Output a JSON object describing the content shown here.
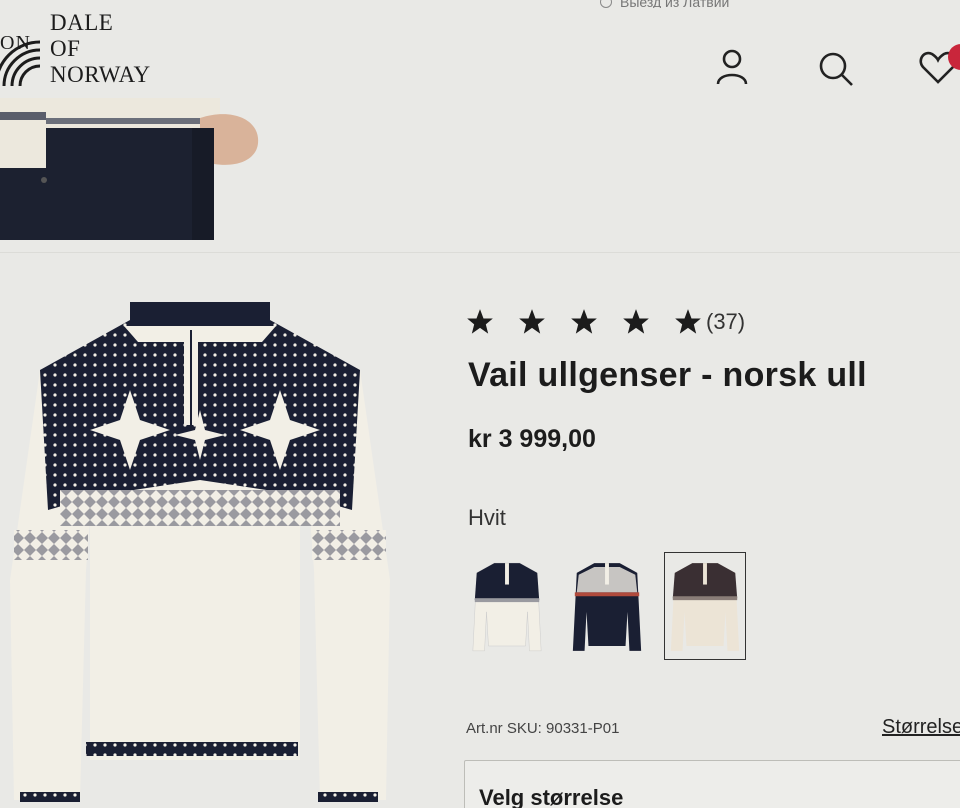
{
  "topbar": {
    "text": "Выезд из Латвии"
  },
  "header": {
    "logo": {
      "line1": "DALE",
      "line2": "OF",
      "line3": "NORWAY",
      "fragment": "ON"
    },
    "icons": [
      "account-icon",
      "search-icon",
      "wishlist-icon"
    ]
  },
  "product": {
    "rating": {
      "stars": 5,
      "max": 5,
      "count": "(37)"
    },
    "title": "Vail ullgenser - norsk ull",
    "price": "kr 3 999,00",
    "color_label": "Hvit",
    "variants": [
      {
        "name": "white-navy",
        "selected": false
      },
      {
        "name": "navy",
        "selected": false
      },
      {
        "name": "white-brown",
        "selected": true
      }
    ],
    "sku": "Art.nr SKU: 90331-P01",
    "size_guide": "Størrelse",
    "size_select": "Velg størrelse"
  },
  "colors": {
    "navy": "#1a1f33",
    "cream": "#f2efe6",
    "badge": "#c9263b"
  }
}
